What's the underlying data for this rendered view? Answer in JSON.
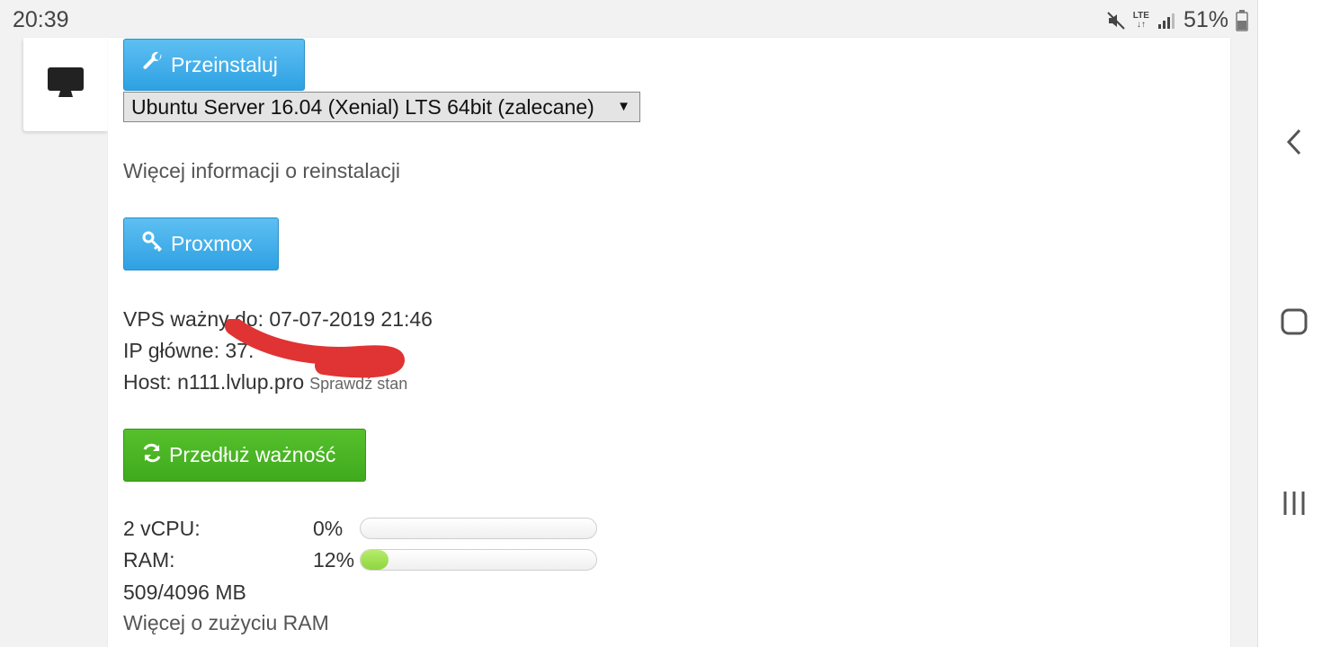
{
  "status_bar": {
    "time": "20:39",
    "network": "LTE",
    "battery": "51%"
  },
  "actions": {
    "reinstall_label": "Przeinstaluj",
    "proxmox_label": "Proxmox",
    "extend_label": "Przedłuż ważność"
  },
  "os_select": {
    "selected": "Ubuntu Server 16.04 (Xenial) LTS 64bit (zalecane)"
  },
  "links": {
    "reinstall_info": "Więcej informacji o reinstalacji",
    "check_status": "Sprawdź stan",
    "ram_info": "Więcej o zużyciu RAM"
  },
  "vps": {
    "valid_until": "VPS ważny do: 07-07-2019 21:46",
    "ip_label": "IP główne:",
    "ip_value": "37.",
    "host": "Host: n111.lvlup.pro"
  },
  "resources": {
    "cpu_label": "2 vCPU:",
    "cpu_percent": "0%",
    "cpu_value": 0,
    "ram_label": "RAM:",
    "ram_percent": "12%",
    "ram_value": 12,
    "ram_usage": "509/4096 MB"
  },
  "colors": {
    "button_blue": "#2ea1e3",
    "button_green": "#3faa1d",
    "progress_green": "#8fd63f",
    "redaction_red": "#e03333"
  },
  "icons": {
    "desktop": "desktop-icon",
    "wrench": "wrench-icon",
    "key": "key-icon",
    "refresh": "refresh-icon"
  }
}
